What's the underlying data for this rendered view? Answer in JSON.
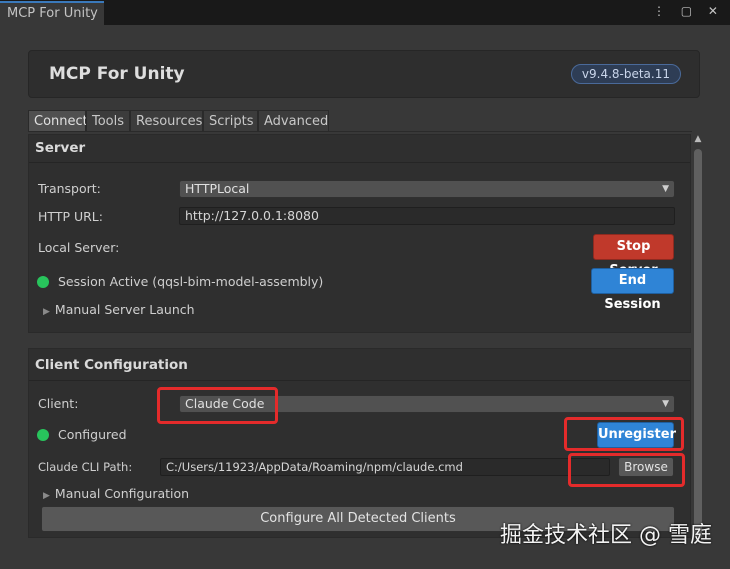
{
  "window": {
    "tab_title": "MCP For Unity",
    "window_icons": "⋮ ▢ ✕"
  },
  "header": {
    "title": "MCP For Unity",
    "version": "v9.4.8-beta.11"
  },
  "tabs": [
    {
      "label": "Connect",
      "active": true
    },
    {
      "label": "Tools"
    },
    {
      "label": "Resources"
    },
    {
      "label": "Scripts"
    },
    {
      "label": "Advanced"
    }
  ],
  "server": {
    "heading": "Server",
    "transport_label": "Transport:",
    "transport_value": "HTTPLocal",
    "http_url_label": "HTTP URL:",
    "http_url_value": "http://127.0.0.1:8080",
    "local_server_label": "Local Server:",
    "stop_server": "Stop Server",
    "session_status": "Session Active (qqsl-bim-model-assembly)",
    "end_session": "End Session",
    "manual_launch": "Manual Server Launch"
  },
  "client": {
    "heading": "Client Configuration",
    "client_label": "Client:",
    "client_value": "Claude Code",
    "status": "Configured",
    "unregister": "Unregister",
    "cli_path_label": "Claude CLI Path:",
    "cli_path_value": "C:/Users/11923/AppData/Roaming/npm/claude.cmd",
    "browse": "Browse",
    "manual_config": "Manual Configuration",
    "configure_all": "Configure All Detected Clients"
  },
  "colors": {
    "status_green": "#28c45c",
    "stop_red": "#c0392b",
    "action_blue": "#2f84d6",
    "annotation_red": "#e42b2b"
  },
  "watermark": "掘金技术社区 @ 雪庭"
}
